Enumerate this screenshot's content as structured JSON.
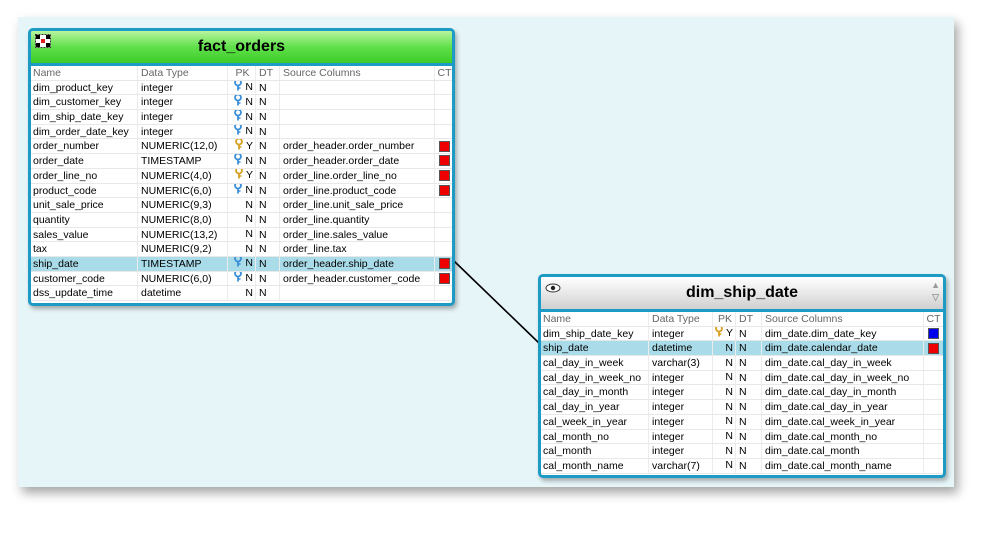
{
  "colors": {
    "frame_border": "#1e9bc4",
    "fact_header": "#3ccb2a",
    "dim_header": "#d6d6d6",
    "selected_row": "#aadbe8",
    "ct_red": "#ee0000",
    "ct_blue": "#0000ee",
    "key_blue": "#3a8fd8",
    "key_gold": "#d8a020"
  },
  "fact_table": {
    "title": "fact_orders",
    "icon": "grid-table-icon",
    "columns": {
      "name": "Name",
      "type": "Data Type",
      "pk": "PK",
      "dt": "DT",
      "src": "Source Columns",
      "ct": "CT"
    },
    "rows": [
      {
        "name": "dim_product_key",
        "type": "integer",
        "key": "blue",
        "pk": "N",
        "dt": "N",
        "src": "",
        "ct": ""
      },
      {
        "name": "dim_customer_key",
        "type": "integer",
        "key": "blue",
        "pk": "N",
        "dt": "N",
        "src": "",
        "ct": ""
      },
      {
        "name": "dim_ship_date_key",
        "type": "integer",
        "key": "blue",
        "pk": "N",
        "dt": "N",
        "src": "",
        "ct": ""
      },
      {
        "name": "dim_order_date_key",
        "type": "integer",
        "key": "blue",
        "pk": "N",
        "dt": "N",
        "src": "",
        "ct": ""
      },
      {
        "name": "order_number",
        "type": "NUMERIC(12,0)",
        "key": "gold",
        "pk": "Y",
        "dt": "N",
        "src": "order_header.order_number",
        "ct": "red"
      },
      {
        "name": "order_date",
        "type": "TIMESTAMP",
        "key": "blue",
        "pk": "N",
        "dt": "N",
        "src": "order_header.order_date",
        "ct": "red"
      },
      {
        "name": "order_line_no",
        "type": "NUMERIC(4,0)",
        "key": "gold",
        "pk": "Y",
        "dt": "N",
        "src": "order_line.order_line_no",
        "ct": "red"
      },
      {
        "name": "product_code",
        "type": "NUMERIC(6,0)",
        "key": "blue",
        "pk": "N",
        "dt": "N",
        "src": "order_line.product_code",
        "ct": "red"
      },
      {
        "name": "unit_sale_price",
        "type": "NUMERIC(9,3)",
        "key": "",
        "pk": "N",
        "dt": "N",
        "src": "order_line.unit_sale_price",
        "ct": ""
      },
      {
        "name": "quantity",
        "type": "NUMERIC(8,0)",
        "key": "",
        "pk": "N",
        "dt": "N",
        "src": "order_line.quantity",
        "ct": ""
      },
      {
        "name": "sales_value",
        "type": "NUMERIC(13,2)",
        "key": "",
        "pk": "N",
        "dt": "N",
        "src": "order_line.sales_value",
        "ct": ""
      },
      {
        "name": "tax",
        "type": "NUMERIC(9,2)",
        "key": "",
        "pk": "N",
        "dt": "N",
        "src": "order_line.tax",
        "ct": ""
      },
      {
        "name": "ship_date",
        "type": "TIMESTAMP",
        "key": "blue",
        "pk": "N",
        "dt": "N",
        "src": "order_header.ship_date",
        "ct": "red",
        "selected": true
      },
      {
        "name": "customer_code",
        "type": "NUMERIC(6,0)",
        "key": "blue",
        "pk": "N",
        "dt": "N",
        "src": "order_header.customer_code",
        "ct": "red"
      },
      {
        "name": "dss_update_time",
        "type": "datetime",
        "key": "",
        "pk": "N",
        "dt": "N",
        "src": "",
        "ct": ""
      }
    ]
  },
  "dim_table": {
    "title": "dim_ship_date",
    "icon": "eye-icon",
    "columns": {
      "name": "Name",
      "type": "Data Type",
      "pk": "PK",
      "dt": "DT",
      "src": "Source Columns",
      "ct": "CT"
    },
    "rows": [
      {
        "name": "dim_ship_date_key",
        "type": "integer",
        "key": "gold",
        "pk": "Y",
        "dt": "N",
        "src": "dim_date.dim_date_key",
        "ct": "blue"
      },
      {
        "name": "ship_date",
        "type": "datetime",
        "key": "",
        "pk": "N",
        "dt": "N",
        "src": "dim_date.calendar_date",
        "ct": "red",
        "selected": true
      },
      {
        "name": "cal_day_in_week",
        "type": "varchar(3)",
        "key": "",
        "pk": "N",
        "dt": "N",
        "src": "dim_date.cal_day_in_week",
        "ct": ""
      },
      {
        "name": "cal_day_in_week_no",
        "type": "integer",
        "key": "",
        "pk": "N",
        "dt": "N",
        "src": "dim_date.cal_day_in_week_no",
        "ct": ""
      },
      {
        "name": "cal_day_in_month",
        "type": "integer",
        "key": "",
        "pk": "N",
        "dt": "N",
        "src": "dim_date.cal_day_in_month",
        "ct": ""
      },
      {
        "name": "cal_day_in_year",
        "type": "integer",
        "key": "",
        "pk": "N",
        "dt": "N",
        "src": "dim_date.cal_day_in_year",
        "ct": ""
      },
      {
        "name": "cal_week_in_year",
        "type": "integer",
        "key": "",
        "pk": "N",
        "dt": "N",
        "src": "dim_date.cal_week_in_year",
        "ct": ""
      },
      {
        "name": "cal_month_no",
        "type": "integer",
        "key": "",
        "pk": "N",
        "dt": "N",
        "src": "dim_date.cal_month_no",
        "ct": ""
      },
      {
        "name": "cal_month",
        "type": "integer",
        "key": "",
        "pk": "N",
        "dt": "N",
        "src": "dim_date.cal_month",
        "ct": ""
      },
      {
        "name": "cal_month_name",
        "type": "varchar(7)",
        "key": "",
        "pk": "N",
        "dt": "N",
        "src": "dim_date.cal_month_name",
        "ct": ""
      }
    ]
  }
}
